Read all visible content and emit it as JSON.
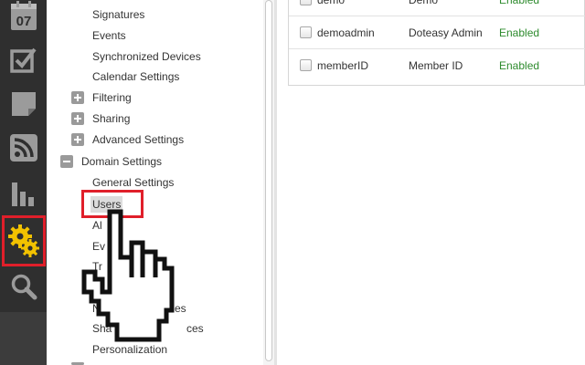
{
  "toolbar": {
    "calendar_date": "07",
    "items": [
      {
        "name": "calendar"
      },
      {
        "name": "tasks"
      },
      {
        "name": "notes"
      },
      {
        "name": "feeds"
      },
      {
        "name": "reports"
      },
      {
        "name": "settings",
        "active": true
      },
      {
        "name": "search"
      }
    ]
  },
  "tree": {
    "items": [
      {
        "label": "Signatures"
      },
      {
        "label": "Events"
      },
      {
        "label": "Synchronized Devices"
      },
      {
        "label": "Calendar Settings"
      },
      {
        "label": "Filtering",
        "toggle": "plus"
      },
      {
        "label": "Sharing",
        "toggle": "plus"
      },
      {
        "label": "Advanced Settings",
        "toggle": "plus"
      },
      {
        "label": "Domain Settings",
        "toggle": "minus"
      },
      {
        "label": "General Settings"
      },
      {
        "label": "Users",
        "selected": true
      },
      {
        "label": "Al"
      },
      {
        "label": "Ev"
      },
      {
        "label": "Tr"
      },
      {
        "label": "N",
        "suffix": "es"
      },
      {
        "label": "Sha",
        "suffix": "ces"
      },
      {
        "label": "Personalization"
      }
    ]
  },
  "user_list": {
    "rows": [
      {
        "username": "demo",
        "display_name": "Demo",
        "status": "Enabled"
      },
      {
        "username": "demoadmin",
        "display_name": "Doteasy Admin",
        "status": "Enabled"
      },
      {
        "username": "memberID",
        "display_name": "Member ID",
        "status": "Enabled"
      }
    ]
  },
  "colors": {
    "highlight_box": "#e01f2a",
    "status_enabled": "#2e8b2e",
    "toolbar_bg": "#2f2f2f",
    "settings_icon": "#f2c200"
  }
}
